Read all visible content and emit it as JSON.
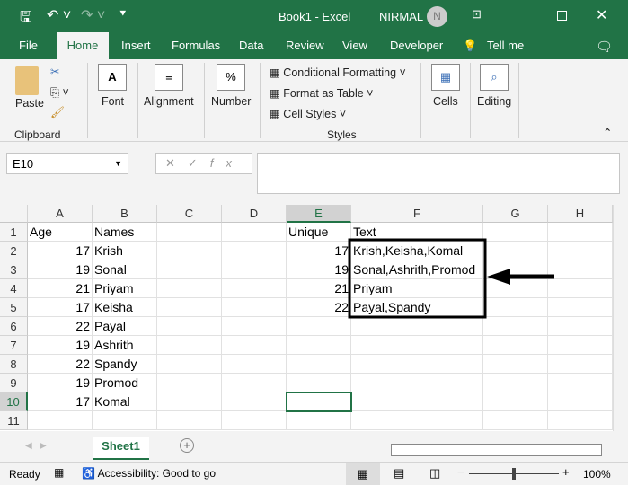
{
  "titlebar": {
    "title": "Book1  -  Excel",
    "user": "NIRMAL",
    "avatar": "N"
  },
  "tabs": [
    "File",
    "Home",
    "Insert",
    "Formulas",
    "Data",
    "Review",
    "View",
    "Developer",
    "Tell me"
  ],
  "ribbon": {
    "paste": "Paste",
    "clipboard": "Clipboard",
    "font": "Font",
    "alignment": "Alignment",
    "number": "Number",
    "conditional": "Conditional Formatting",
    "format_table": "Format as Table",
    "cell_styles": "Cell Styles",
    "styles": "Styles",
    "cells": "Cells",
    "editing": "Editing"
  },
  "formula_bar": {
    "name_box": "E10",
    "value": ""
  },
  "columns": [
    "A",
    "B",
    "C",
    "D",
    "E",
    "F",
    "G",
    "H"
  ],
  "rows": [
    "1",
    "2",
    "3",
    "4",
    "5",
    "6",
    "7",
    "8",
    "9",
    "10",
    "11"
  ],
  "cells": {
    "A": [
      "Age",
      "17",
      "19",
      "21",
      "17",
      "22",
      "19",
      "22",
      "19",
      "17"
    ],
    "B": [
      "Names",
      "Krish",
      "Sonal",
      "Priyam",
      "Keisha",
      "Payal",
      "Ashrith",
      "Spandy",
      "Promod",
      "Komal"
    ],
    "E": [
      "Unique",
      "17",
      "19",
      "21",
      "22"
    ],
    "F": [
      "Text",
      "Krish,Keisha,Komal",
      "Sonal,Ashrith,Promod",
      "Priyam",
      "Payal,Spandy"
    ]
  },
  "sheet_tab": "Sheet1",
  "status": {
    "ready": "Ready",
    "accessibility": "Accessibility: Good to go",
    "zoom": "100%"
  }
}
